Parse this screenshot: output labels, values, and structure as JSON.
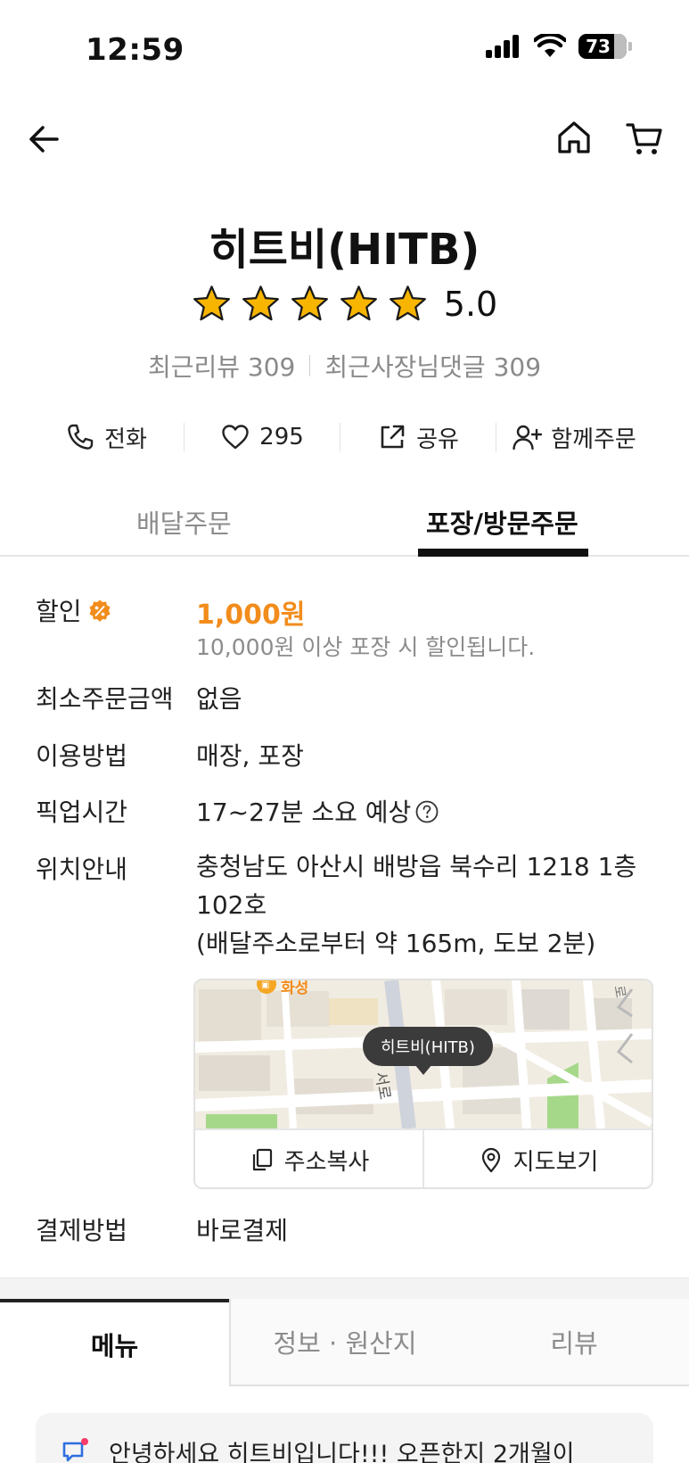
{
  "status_bar": {
    "time": "12:59",
    "battery": "73",
    "battery_level_percent": 73
  },
  "store": {
    "name": "히트비(HITB)",
    "rating": "5.0",
    "stars": 5,
    "recent_reviews": "최근리뷰 309",
    "owner_replies": "최근사장님댓글 309"
  },
  "actions": {
    "call": "전화",
    "likes": "295",
    "share": "공유",
    "group_order": "함께주문"
  },
  "order_tabs": {
    "delivery": "배달주문",
    "pickup": "포장/방문주문",
    "selected": "pickup"
  },
  "info": {
    "discount_label": "할인",
    "discount_amount": "1,000원",
    "discount_note": "10,000원 이상 포장 시 할인됩니다.",
    "min_order_label": "최소주문금액",
    "min_order_value": "없음",
    "usage_label": "이용방법",
    "usage_value": "매장, 포장",
    "pickup_time_label": "픽업시간",
    "pickup_time_value": "17~27분 소요 예상",
    "location_label": "위치안내",
    "address_line1": "충청남도 아산시 배방읍 북수리 1218 1층",
    "address_line2": "102호",
    "distance": "(배달주소로부터 약 165m, 도보 2분)",
    "payment_label": "결제방법",
    "payment_value": "바로결제"
  },
  "map": {
    "pin_label": "히트비(HITB)",
    "poi_label": "화성",
    "road_label": "서로",
    "corner_label": "로",
    "copy_address": "주소복사",
    "view_map": "지도보기"
  },
  "bottom_tabs": {
    "menu": "메뉴",
    "info": "정보 · 원산지",
    "review": "리뷰",
    "selected": "menu"
  },
  "notice": {
    "text": "안녕하세요 히트비입니다!!! 오픈한지 2개월이"
  },
  "colors": {
    "accent_orange": "#f28c1b",
    "star_yellow": "#f7b500",
    "map_park": "#a6d88a"
  }
}
